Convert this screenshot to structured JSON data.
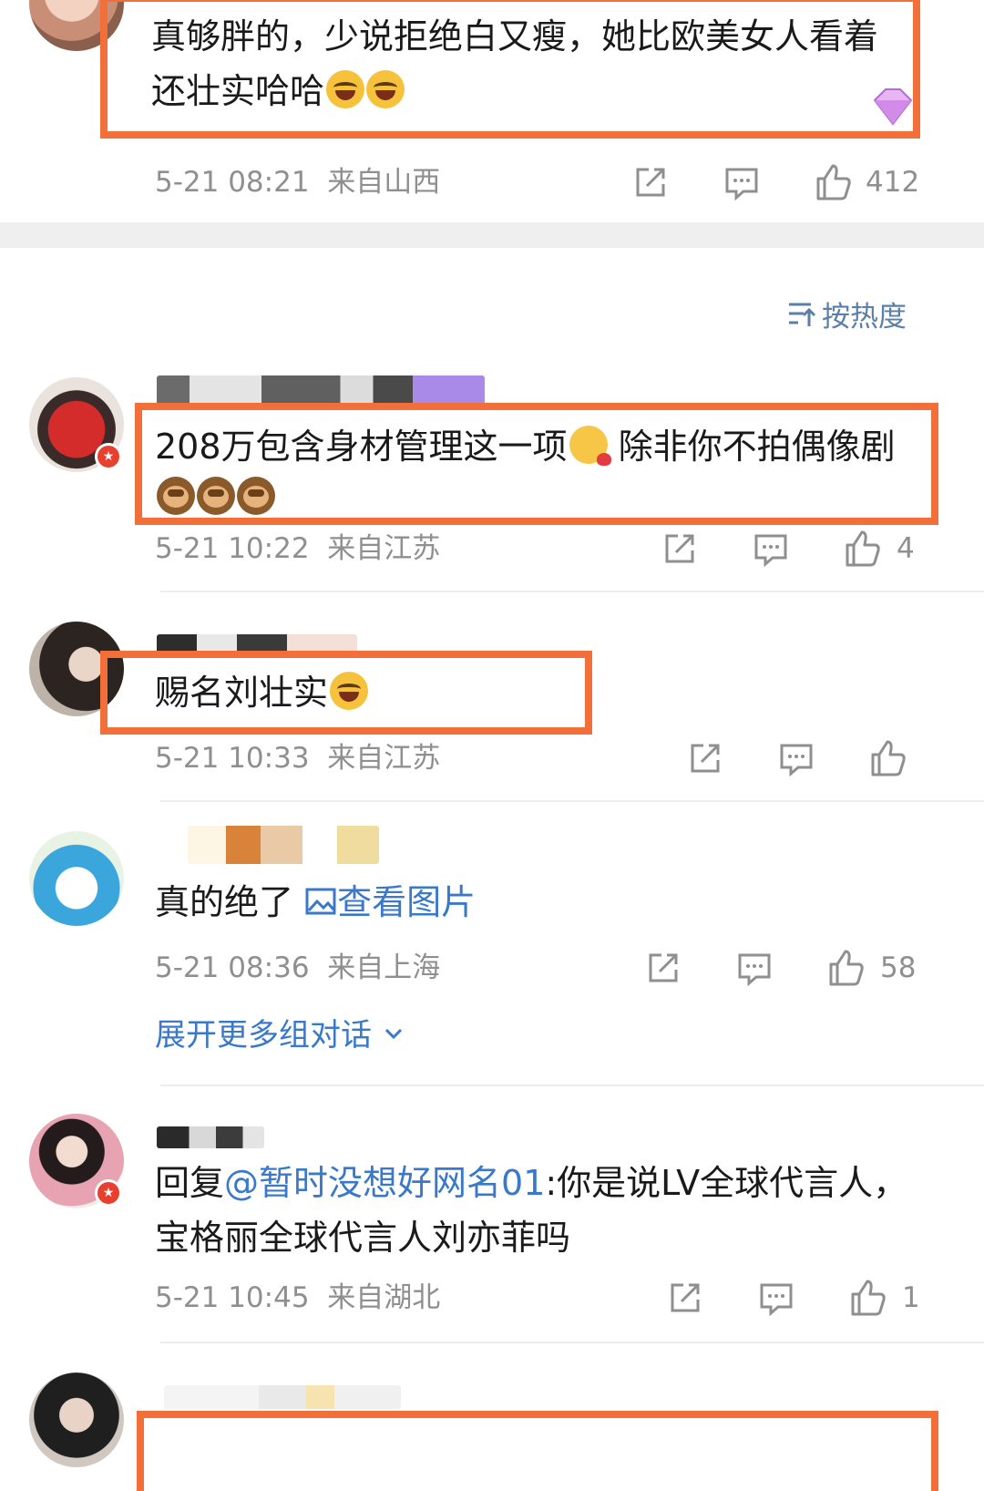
{
  "colors": {
    "highlight": "#f26f3a",
    "link": "#3a79c9",
    "meta": "#8f8f8f",
    "badge": "#e8402f"
  },
  "sort_control": {
    "label": "按热度",
    "icon": "sort-icon"
  },
  "comments": [
    {
      "text_lines": [
        "真够胖的，少说拒绝白又瘦，她比欧美女人看着",
        "还壮实哈哈"
      ],
      "emojis": [
        "laugh",
        "laugh"
      ],
      "time": "5-21 08:21",
      "location": "来自山西",
      "likes": "412"
    },
    {
      "text_lines": [
        "208万包含身材管理这一项",
        "除非你不拍偶像剧"
      ],
      "emojis": [
        "shy",
        "monkey",
        "monkey",
        "monkey"
      ],
      "time": "5-21 10:22",
      "location": "来自江苏",
      "likes": "4"
    },
    {
      "text_lines": [
        "赐名刘壮实"
      ],
      "emojis": [
        "laugh"
      ],
      "time": "5-21 10:33",
      "location": "来自江苏",
      "likes": ""
    },
    {
      "text_lines": [
        "真的绝了"
      ],
      "view_image": "查看图片",
      "time": "5-21 08:36",
      "location": "来自上海",
      "likes": "58",
      "expand_label": "展开更多组对话"
    },
    {
      "reply_prefix": "回复",
      "mention": "@暂时没想好网名01",
      "text_lines": [
        ":你是说LV全球代言人，",
        "宝格丽全球代言人刘亦菲吗"
      ],
      "time": "5-21 10:45",
      "location": "来自湖北",
      "likes": "1"
    }
  ]
}
